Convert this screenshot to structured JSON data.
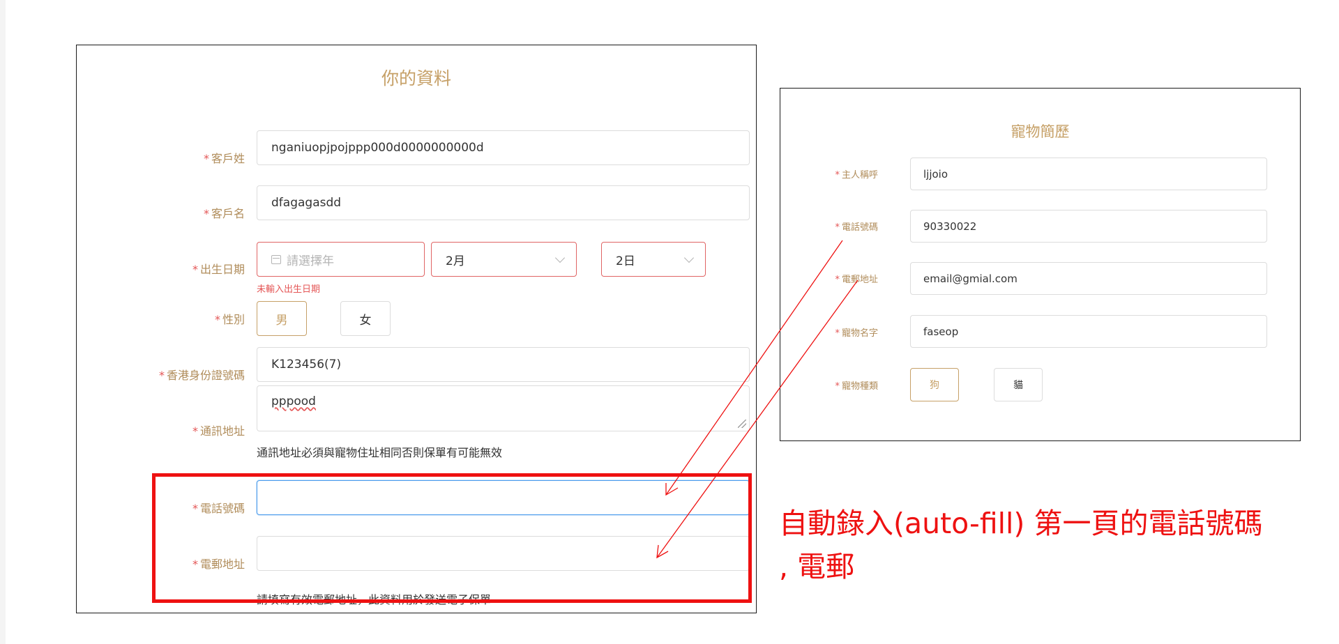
{
  "form_left": {
    "title": "你的資料",
    "required_mark": "*",
    "surname": {
      "label": "客戶姓",
      "value": "nganiuopjpojppp000d0000000000d"
    },
    "given_name": {
      "label": "客戶名",
      "value": "dfagagasdd"
    },
    "dob": {
      "label": "出生日期",
      "year_placeholder": "請選擇年",
      "month_value": "2月",
      "day_value": "2日",
      "error": "未輸入出生日期"
    },
    "gender": {
      "label": "性別",
      "options": [
        "男",
        "女"
      ],
      "selected": "男"
    },
    "hkid": {
      "label": "香港身份證號碼",
      "value": "K123456(7)"
    },
    "address": {
      "label": "通訊地址",
      "value": "pppood",
      "hint": "通訊地址必須與寵物住址相同否則保單有可能無效"
    },
    "phone": {
      "label": "電話號碼",
      "value": ""
    },
    "email": {
      "label": "電郵地址",
      "value": "",
      "hint": "請填寫有效電郵地址，此資料用於發送電子保單"
    }
  },
  "form_right": {
    "title": "寵物簡歷",
    "owner_name": {
      "label": "主人稱呼",
      "value": "ljjoio"
    },
    "phone": {
      "label": "電話號碼",
      "value": "90330022"
    },
    "email": {
      "label": "電郵地址",
      "value": "email@gmial.com"
    },
    "pet_name": {
      "label": "寵物名字",
      "value": "faseop"
    },
    "pet_type": {
      "label": "寵物種類",
      "options": [
        "狗",
        "貓"
      ],
      "selected": "狗"
    }
  },
  "annotation": {
    "line1": "自動錄入(auto-fill) 第一頁的電話號碼",
    "line2": ", 電郵",
    "color": "#ee1111"
  },
  "colors": {
    "accent_gold": "#c6a067",
    "error_red": "#e45656",
    "focus_blue": "#4a9bec"
  }
}
